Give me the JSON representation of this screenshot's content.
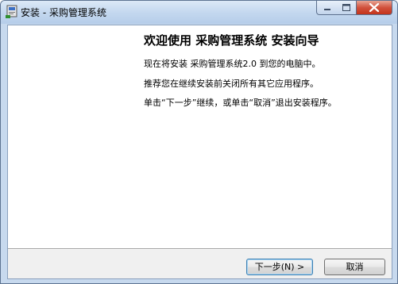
{
  "window": {
    "title": "安装 - 采购管理系统"
  },
  "wizard": {
    "heading": "欢迎使用 采购管理系统 安装向导",
    "paragraphs": [
      "现在将安装 采购管理系统2.0 到您的电脑中。",
      "推荐您在继续安装前关闭所有其它应用程序。",
      "单击“下一步”继续，或单击“取消”退出安装程序。"
    ]
  },
  "buttons": {
    "next": "下一步(N) >",
    "cancel": "取消"
  },
  "icons": {
    "app": "installer-icon",
    "minimize": "minimize-icon",
    "maximize": "maximize-icon",
    "close": "close-icon"
  }
}
